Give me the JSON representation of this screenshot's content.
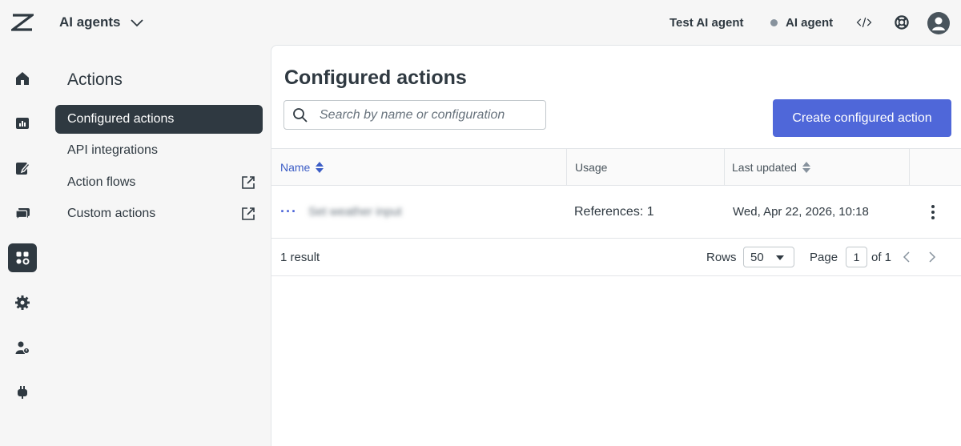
{
  "topbar": {
    "app_switcher_label": "AI agents",
    "agent_name": "Test AI agent",
    "agent_type": "AI agent"
  },
  "sidebar_title": "Actions",
  "sidebar_items": [
    {
      "label": "Configured actions",
      "active": true,
      "external": false
    },
    {
      "label": "API integrations",
      "active": false,
      "external": false
    },
    {
      "label": "Action flows",
      "active": false,
      "external": true
    },
    {
      "label": "Custom actions",
      "active": false,
      "external": true
    }
  ],
  "rail_icons": [
    "home-icon",
    "analytics-icon",
    "knowledge-icon",
    "conversations-icon",
    "actions-icon",
    "settings-icon",
    "team-icon",
    "integrations-icon"
  ],
  "main": {
    "title": "Configured actions",
    "search_placeholder": "Search by name or configuration",
    "create_button": "Create configured action"
  },
  "table": {
    "columns": {
      "name": "Name",
      "usage": "Usage",
      "last_updated": "Last updated"
    },
    "rows": [
      {
        "name": "Set weather input",
        "usage": "References: 1",
        "last_updated": "Wed, Apr 22, 2026, 10:18"
      }
    ]
  },
  "footer": {
    "result_count": "1 result",
    "rows_label": "Rows",
    "rows_value": "50",
    "page_label": "Page",
    "page_value": "1",
    "of_label": "of 1"
  },
  "colors": {
    "accent": "#4f67d9",
    "dark": "#2f3941"
  }
}
